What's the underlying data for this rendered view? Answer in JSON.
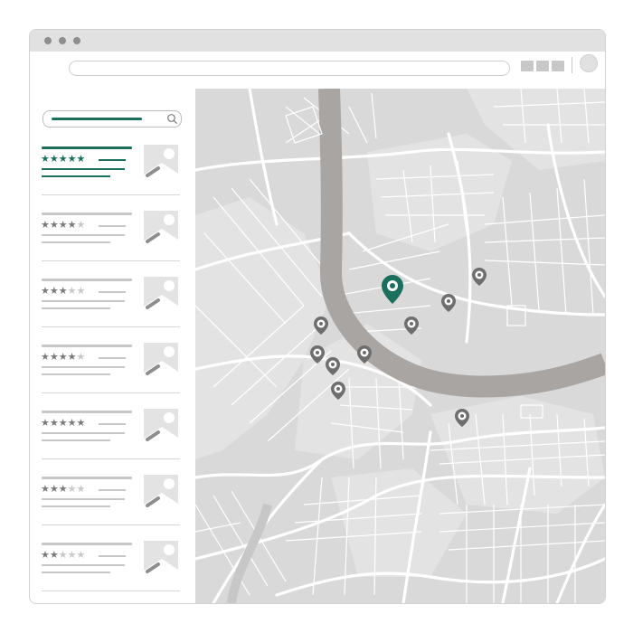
{
  "colors": {
    "accent": "#1b6f5c",
    "map_background": "#d9d9d9",
    "river": "#a9a5a2",
    "roads": "#ffffff",
    "pin": "#6e6e6e"
  },
  "toolbar": {
    "window_controls": [
      "close",
      "minimize",
      "maximize"
    ],
    "icons": [
      "apps-grid-icon",
      "profile-icon"
    ]
  },
  "search": {
    "icon": "search-icon"
  },
  "listings": [
    {
      "rating": 5,
      "max_rating": 5,
      "selected": true
    },
    {
      "rating": 4,
      "max_rating": 5,
      "selected": false
    },
    {
      "rating": 3,
      "max_rating": 5,
      "selected": false
    },
    {
      "rating": 4,
      "max_rating": 5,
      "selected": false
    },
    {
      "rating": 5,
      "max_rating": 5,
      "selected": false
    },
    {
      "rating": 3,
      "max_rating": 5,
      "selected": false
    },
    {
      "rating": 2,
      "max_rating": 5,
      "selected": false
    }
  ],
  "map": {
    "selected_pin_icon": "location-pin-icon",
    "pin_icon": "location-pin-icon",
    "pin_count": 10
  }
}
